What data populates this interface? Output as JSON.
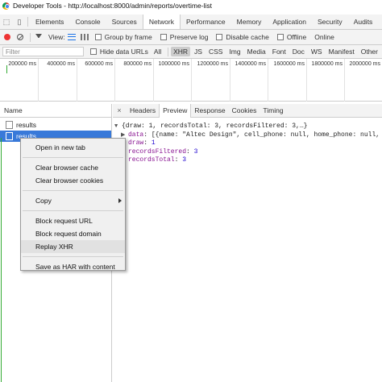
{
  "window": {
    "title": "Developer Tools - http://localhost:8000/admin/reports/overtime-list"
  },
  "tabs": [
    {
      "label": "Elements",
      "active": false
    },
    {
      "label": "Console",
      "active": false
    },
    {
      "label": "Sources",
      "active": false
    },
    {
      "label": "Network",
      "active": true
    },
    {
      "label": "Performance",
      "active": false
    },
    {
      "label": "Memory",
      "active": false
    },
    {
      "label": "Application",
      "active": false
    },
    {
      "label": "Security",
      "active": false
    },
    {
      "label": "Audits",
      "active": false
    }
  ],
  "toolbar": {
    "view_label": "View:",
    "group_by_frame": "Group by frame",
    "preserve_log": "Preserve log",
    "disable_cache": "Disable cache",
    "offline": "Offline",
    "throttle": "Online"
  },
  "filterbar": {
    "placeholder": "Filter",
    "hide_data_urls": "Hide data URLs",
    "types": [
      "All",
      "XHR",
      "JS",
      "CSS",
      "Img",
      "Media",
      "Font",
      "Doc",
      "WS",
      "Manifest",
      "Other"
    ],
    "selected_type": "XHR"
  },
  "overview": {
    "ticks": [
      "200000 ms",
      "400000 ms",
      "600000 ms",
      "800000 ms",
      "1000000 ms",
      "1200000 ms",
      "1400000 ms",
      "1600000 ms",
      "1800000 ms",
      "2000000 ms"
    ]
  },
  "requests": {
    "header": "Name",
    "rows": [
      {
        "name": "results",
        "selected": false
      },
      {
        "name": "results",
        "selected": true
      }
    ]
  },
  "detail": {
    "close": "×",
    "tabs": [
      {
        "label": "Headers",
        "active": false
      },
      {
        "label": "Preview",
        "active": true
      },
      {
        "label": "Response",
        "active": false
      },
      {
        "label": "Cookies",
        "active": false
      },
      {
        "label": "Timing",
        "active": false
      }
    ],
    "json": {
      "root": "{draw: 1, recordsTotal: 3, recordsFiltered: 3,…}",
      "data_key": "data",
      "data_value": "[{name: \"Altec Design\", cell_phone: null, home_phone: null, tot",
      "draw_key": "draw",
      "draw_value": "1",
      "filtered_key": "recordsFiltered",
      "filtered_value": "3",
      "total_key": "recordsTotal",
      "total_value": "3"
    }
  },
  "context_menu": {
    "items": [
      "Open in new tab",
      "Clear browser cache",
      "Clear browser cookies",
      "Copy",
      "Block request URL",
      "Block request domain",
      "Replay XHR",
      "Save as HAR with content"
    ],
    "highlighted": "Replay XHR"
  }
}
